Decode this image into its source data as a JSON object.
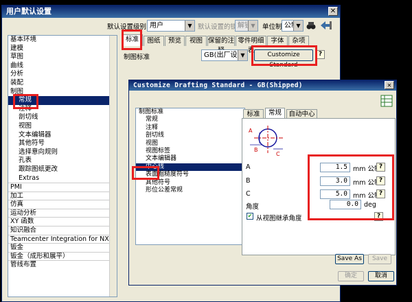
{
  "window": {
    "title": "用户默认设置"
  },
  "toolbar": {
    "level_label": "默认设置级别",
    "level_value": "用户",
    "lock_label": "默认设置的锁定状态",
    "lock_value": "解锁",
    "units_label": "单位制",
    "units_value": "公制"
  },
  "left_tree": [
    {
      "label": "基本环境",
      "indent": 0
    },
    {
      "label": "建模",
      "indent": 0
    },
    {
      "label": "草图",
      "indent": 0
    },
    {
      "label": "曲线",
      "indent": 0
    },
    {
      "label": "分析",
      "indent": 0
    },
    {
      "label": "装配",
      "indent": 0
    },
    {
      "label": "制图",
      "indent": 0
    },
    {
      "label": "常规",
      "indent": 1,
      "selected": true
    },
    {
      "label": "注释",
      "indent": 1
    },
    {
      "label": "剖切线",
      "indent": 1
    },
    {
      "label": "视图",
      "indent": 1
    },
    {
      "label": "文本编辑器",
      "indent": 1
    },
    {
      "label": "其他符号",
      "indent": 1
    },
    {
      "label": "选择意向规则",
      "indent": 1
    },
    {
      "label": "孔表",
      "indent": 1
    },
    {
      "label": "跟踪图纸更改",
      "indent": 1
    },
    {
      "label": "Extras",
      "indent": 1
    },
    {
      "label": "PMI",
      "indent": 0
    },
    {
      "label": "加工",
      "indent": 0
    },
    {
      "label": "仿真",
      "indent": 0
    },
    {
      "label": "运动分析",
      "indent": 0
    },
    {
      "label": "XY 函数",
      "indent": 0
    },
    {
      "label": "知识融合",
      "indent": 0
    },
    {
      "label": "Teamcenter Integration for NX",
      "indent": 0
    },
    {
      "label": "钣金",
      "indent": 0
    },
    {
      "label": "钣金（成形和展平）",
      "indent": 0
    },
    {
      "label": "管线布置",
      "indent": 0
    }
  ],
  "tabs": [
    "标准",
    "图纸",
    "预览",
    "视图",
    "保留的注释",
    "零件明细表",
    "字体",
    "杂项"
  ],
  "standard": {
    "label": "制图标准",
    "value": "GB(出厂设置)",
    "customize_button": "Customize Standard"
  },
  "dialog": {
    "title": "Customize Drafting Standard - GB(Shipped)",
    "tree": [
      {
        "label": "制图标准",
        "indent": 0
      },
      {
        "label": "常规",
        "indent": 1
      },
      {
        "label": "注释",
        "indent": 1
      },
      {
        "label": "剖切线",
        "indent": 1
      },
      {
        "label": "视图",
        "indent": 1
      },
      {
        "label": "视图标签",
        "indent": 1
      },
      {
        "label": "文本编辑器",
        "indent": 1
      },
      {
        "label": "中心线",
        "indent": 1,
        "selected": true
      },
      {
        "label": "表面粗糙度符号",
        "indent": 1
      },
      {
        "label": "其他符号",
        "indent": 1
      },
      {
        "label": "形位公差常规",
        "indent": 1
      }
    ],
    "tabs": [
      "标准",
      "常规",
      "自动中心线"
    ],
    "fields": [
      {
        "label": "A",
        "value": "1.5",
        "unit": "mm 公制"
      },
      {
        "label": "B",
        "value": "3.0",
        "unit": "mm 公制"
      },
      {
        "label": "C",
        "value": "5.0",
        "unit": "mm 公制"
      }
    ],
    "angle": {
      "label": "角度",
      "value": "0.0",
      "unit": "deg"
    },
    "inherit": {
      "label": "从视图继承角度",
      "checked": true
    },
    "save_as": "Save As",
    "save": "Save",
    "ok": "确定",
    "cancel": "取消"
  },
  "diagram": {
    "labels": [
      "A",
      "B",
      "C"
    ]
  }
}
